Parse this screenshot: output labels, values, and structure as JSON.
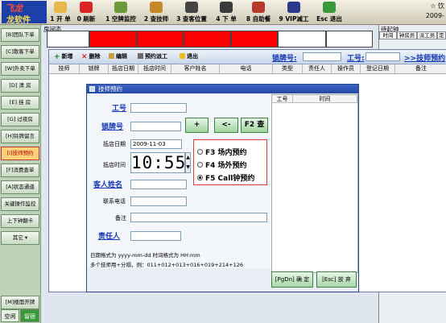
{
  "toolbar": {
    "logo_line1": "飞龙",
    "logo_line2": "龙软件",
    "buttons": [
      {
        "key": "1",
        "label": "开单",
        "full": "1 开 单"
      },
      {
        "key": "2",
        "label": "0 刷新"
      },
      {
        "key": "3",
        "label": "1 空牌监控"
      },
      {
        "key": "4",
        "label": "2 查技师"
      },
      {
        "key": "5",
        "label": "3 查客位置"
      },
      {
        "key": "6",
        "label": "4 下 单"
      },
      {
        "key": "7",
        "label": "8 自助餐"
      },
      {
        "key": "8",
        "label": "9 VIP减工"
      },
      {
        "key": "9",
        "label": "Esc 退出"
      }
    ],
    "right_line1": "☆ 饮",
    "right_line2": "2009-"
  },
  "sidebar": {
    "items": [
      "[B]团队下单",
      "[C]散客下单",
      "[W]外卖下单",
      "[D] 清 房",
      "[E] 挂 房",
      "[G] 过夜房",
      "[H]铃牌留言",
      "[I]技师预约",
      "[F]消费查单",
      "[A]状态通道",
      "关键操作监控",
      "上下钟翻卡",
      "其它"
    ],
    "bottom_item": "[M]楼面开牌",
    "bottom_buttons": [
      "空闲",
      "留宿"
    ]
  },
  "room_area": {
    "label": "房间态"
  },
  "right_panel": {
    "title": "待起钟",
    "tabs": [
      "时间",
      "钟房员",
      "派工员",
      "定"
    ]
  },
  "main_window": {
    "toolbar": {
      "add": "新增",
      "delete": "删除",
      "edit": "编辑",
      "reserve": "预约派工",
      "exit": "退出"
    },
    "card_label": "锁牌号:",
    "worker_label": "工号:",
    "link_label": ">>技师预约",
    "columns": [
      "技师",
      "锁牌",
      "抵店日期",
      "抵店时间",
      "客户姓名",
      "电话",
      "类型",
      "责任人",
      "操作员",
      "登记日期",
      "备注"
    ]
  },
  "dialog": {
    "title": "技师预约",
    "work_no_label": "工号",
    "card_label": "锁牌号",
    "date_label": "抵店日期",
    "date_value": "2009-11-03",
    "time_label": "抵店时间",
    "time_value": "10:55",
    "name_label": "客人姓名",
    "phone_label": "联系电话",
    "note_label": "备注",
    "owner_label": "责任人",
    "plus_button": "+",
    "back_button": "<-",
    "query_button": "F2 查",
    "options": [
      {
        "label": "F3 场内预约",
        "checked": false
      },
      {
        "label": "F4 场外预约",
        "checked": false
      },
      {
        "label": "F5 Call钟预约",
        "checked": true
      }
    ],
    "hint1": "日期格式为 yyyy-mm-dd    时间格式为 HH:mm",
    "hint2": "多个技师用+分隔，例：011+012+013+016+019+214+126",
    "grid_columns": [
      "工号",
      "时间"
    ],
    "confirm_button": "[PgDn] 确 定",
    "cancel_button": "[Esc] 放 弃"
  },
  "colors": {
    "accent": "#1436b4",
    "room_occupied": "#ff0000",
    "dialog_title": "#2448a4"
  }
}
